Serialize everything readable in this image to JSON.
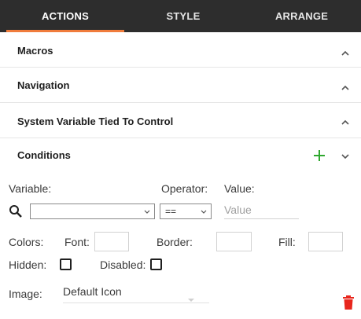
{
  "tabs": [
    {
      "label": "ACTIONS",
      "active": true
    },
    {
      "label": "STYLE",
      "active": false
    },
    {
      "label": "ARRANGE",
      "active": false
    }
  ],
  "sections": {
    "macros": "Macros",
    "navigation": "Navigation",
    "system_variable": "System Variable Tied To Control",
    "conditions": "Conditions"
  },
  "condition": {
    "variable_label": "Variable:",
    "operator_label": "Operator:",
    "value_label": "Value:",
    "variable_value": "",
    "operator_value": "==",
    "value_placeholder": "Value",
    "colors_label": "Colors:",
    "font_label": "Font:",
    "border_label": "Border:",
    "fill_label": "Fill:",
    "hidden_label": "Hidden:",
    "disabled_label": "Disabled:",
    "hidden_checked": false,
    "disabled_checked": false,
    "image_label": "Image:",
    "image_value": "Default Icon"
  },
  "icons": {
    "search": "search-icon",
    "add": "plus-icon",
    "delete": "trash-icon",
    "collapse": "chevron-up-icon",
    "expand": "chevron-down-icon"
  },
  "colors": {
    "tab_bar": "#2d2d2d",
    "tab_accent": "#f07c3c",
    "add_green": "#2ea82e",
    "delete_red": "#e8261d"
  }
}
